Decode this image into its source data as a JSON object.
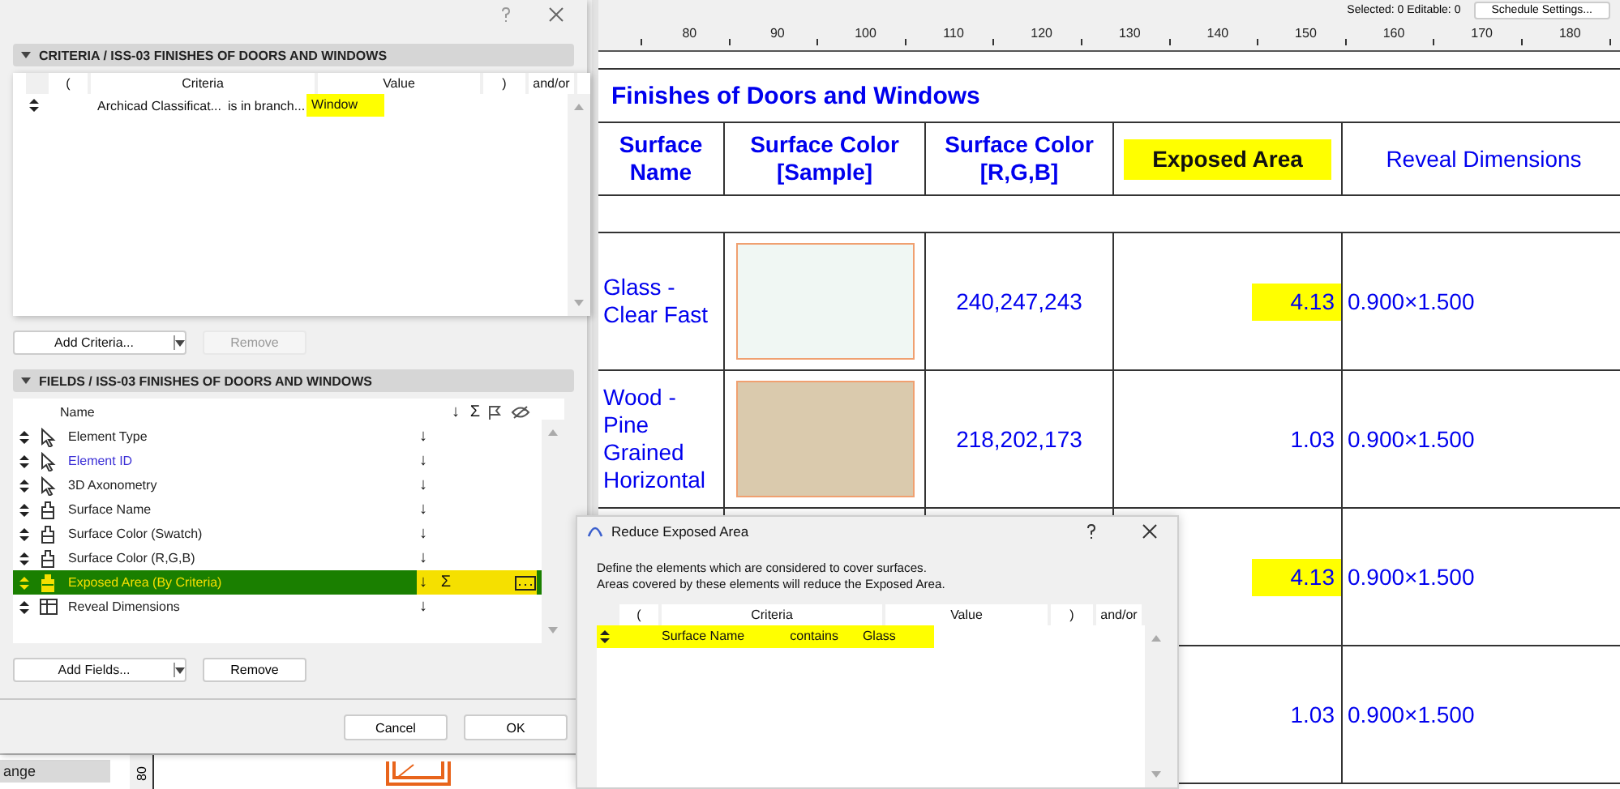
{
  "status": {
    "selection": "Selected: 0  Editable: 0",
    "button": "Schedule Settings..."
  },
  "ruler": {
    "labels": [
      "80",
      "90",
      "100",
      "110",
      "120",
      "130",
      "140",
      "150",
      "160",
      "170",
      "180"
    ]
  },
  "schedule": {
    "title": "Finishes of Doors and Windows",
    "columns": [
      {
        "label": "Surface Name",
        "highlighted": false,
        "bold": true
      },
      {
        "label": "Surface Color [Sample]",
        "highlighted": false,
        "bold": true
      },
      {
        "label": "Surface Color [R,G,B]",
        "highlighted": false,
        "bold": true
      },
      {
        "label": "Exposed Area",
        "highlighted": true,
        "bold": true
      },
      {
        "label": "Reveal Dimensions",
        "highlighted": false,
        "bold": false
      }
    ],
    "rows": [
      {
        "surface_name": "Glass - Clear Fast",
        "color": "#f0f7f3",
        "rgb": "240,247,243",
        "exposed_area": "4.13",
        "area_highlighted": true,
        "reveal": "0.900×1.500"
      },
      {
        "surface_name": "Wood - Pine Grained Horizontal",
        "color": "#dacaad",
        "rgb": "218,202,173",
        "exposed_area": "1.03",
        "area_highlighted": false,
        "reveal": "0.900×1.500"
      },
      {
        "exposed_area": "4.13",
        "area_highlighted": true,
        "reveal": "0.900×1.500"
      },
      {
        "exposed_area": "1.03",
        "area_highlighted": false,
        "reveal": "0.900×1.500"
      }
    ]
  },
  "criteria_dialog": {
    "criteria_panel": {
      "title": "CRITERIA / ISS-03 FINISHES OF DOORS AND WINDOWS",
      "columns": [
        "(",
        "Criteria",
        "Value",
        ")",
        "and/or"
      ],
      "rows": [
        {
          "criterion": "Archicad Classificat...",
          "operator": "is in branch...",
          "value": "Window",
          "highlighted": true
        }
      ],
      "add_button": "Add Criteria...",
      "remove_button": {
        "label": "Remove",
        "disabled": true
      }
    },
    "fields_panel": {
      "title": "FIELDS / ISS-03 FINISHES OF DOORS AND WINDOWS",
      "name_column": "Name",
      "sort_column": "↓",
      "sum_column": "Σ",
      "fields": [
        {
          "name": "Element Type",
          "kind": "pointer",
          "sort": "↓",
          "selected": false,
          "linked": false
        },
        {
          "name": "Element ID",
          "kind": "pointer",
          "sort": "↓",
          "selected": false,
          "linked": true
        },
        {
          "name": "3D Axonometry",
          "kind": "pointer",
          "sort": "↓",
          "selected": false,
          "linked": false
        },
        {
          "name": "Surface Name",
          "kind": "brush",
          "sort": "↓",
          "selected": false,
          "linked": false
        },
        {
          "name": "Surface Color (Swatch)",
          "kind": "brush",
          "sort": "↓",
          "selected": false,
          "linked": false
        },
        {
          "name": "Surface Color (R,G,B)",
          "kind": "brush",
          "sort": "↓",
          "selected": false,
          "linked": false
        },
        {
          "name": "Exposed Area (By Criteria)",
          "kind": "brush",
          "sort": "↓",
          "sum": "Σ",
          "selected": true,
          "linked": false
        },
        {
          "name": "Reveal Dimensions",
          "kind": "grid",
          "sort": "↓",
          "selected": false,
          "linked": false
        }
      ],
      "add_button": "Add Fields...",
      "remove_button": {
        "label": "Remove",
        "disabled": false
      }
    },
    "buttons": [
      "Cancel",
      "OK"
    ]
  },
  "background_panel": {
    "tab": "ange",
    "ruler_label": "80"
  },
  "reduce_dialog": {
    "title": "Reduce Exposed Area",
    "description": [
      "Define the elements which are considered to cover surfaces.",
      "Areas covered by these elements will reduce the Exposed Area."
    ],
    "columns": [
      "(",
      "Criteria",
      "Value",
      ")",
      "and/or"
    ],
    "rows": [
      {
        "criterion": "Surface Name",
        "operator": "contains",
        "value": "Glass",
        "highlighted": true
      }
    ]
  }
}
